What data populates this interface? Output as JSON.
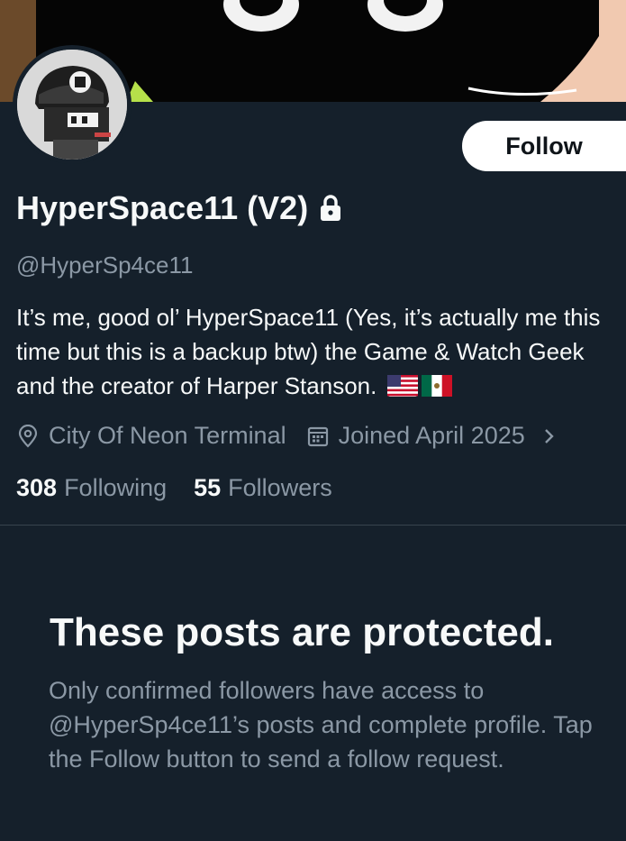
{
  "profile": {
    "display_name": "HyperSpace11 (V2)",
    "handle": "@HyperSp4ce11",
    "bio": "It’s me, good ol’ HyperSpace11 (Yes, it’s actually me this time but this is a backup btw) the Game & Watch Geek and the creator of Harper Stanson.",
    "bio_flags": [
      "us-flag",
      "mexico-flag"
    ],
    "location": "City Of Neon Terminal",
    "joined": "Joined April 2025",
    "following_count": "308",
    "following_label": "Following",
    "followers_count": "55",
    "followers_label": "Followers",
    "protected": true
  },
  "actions": {
    "follow_label": "Follow"
  },
  "protected_notice": {
    "title": "These posts are protected.",
    "description": "Only confirmed followers have access to @HyperSp4ce11’s posts and complete profile. Tap the Follow button to send a follow request."
  },
  "icons": {
    "lock": "lock-icon",
    "location": "location-pin-icon",
    "calendar": "calendar-icon",
    "chevron": "chevron-right-icon"
  },
  "colors": {
    "background": "#15202b",
    "text_primary": "#f7f9f9",
    "text_secondary": "#8b98a5",
    "divider": "#38444d",
    "button_bg": "#ffffff",
    "button_text": "#0f1419"
  }
}
